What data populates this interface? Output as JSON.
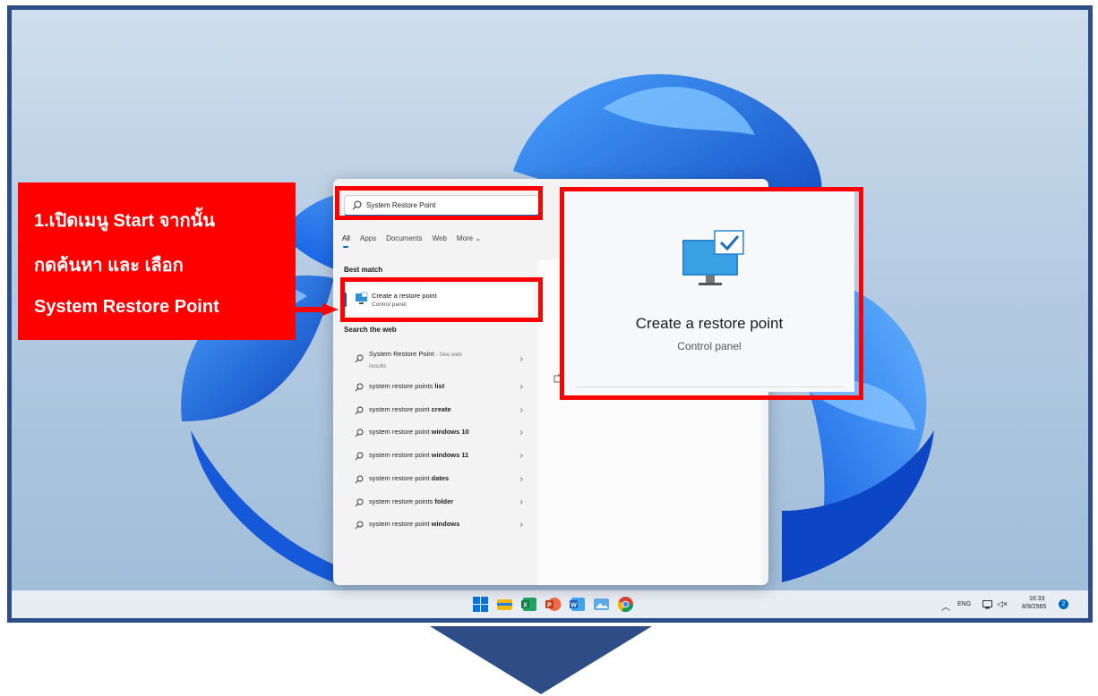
{
  "search": {
    "query": "System Restore Point"
  },
  "tabs": [
    "All",
    "Apps",
    "Documents",
    "Web",
    "More ⌄"
  ],
  "best_match": {
    "heading": "Best match",
    "title": "Create a restore point",
    "subtitle": "Control panel"
  },
  "web": {
    "heading": "Search the web",
    "first": {
      "query": "System Restore Point",
      "suffix": "- See web",
      "suffix2": "results"
    },
    "suggestions": [
      {
        "prefix": "system restore points ",
        "bold": "list"
      },
      {
        "prefix": "system restore point ",
        "bold": "create"
      },
      {
        "prefix": "system restore point ",
        "bold": "windows 10"
      },
      {
        "prefix": "system restore point ",
        "bold": "windows 11"
      },
      {
        "prefix": "system restore point ",
        "bold": "dates"
      },
      {
        "prefix": "system restore points ",
        "bold": "folder"
      },
      {
        "prefix": "system restore point ",
        "bold": "windows"
      }
    ]
  },
  "detail": {
    "title": "Create a restore point",
    "subtitle": "Control panel"
  },
  "callout": {
    "line1": "1.เปิดเมนู Start จากนั้น",
    "line2": "กดค้นหา และ เลือก",
    "line3": "System Restore Point"
  },
  "tray": {
    "language": "ENG",
    "time": "16:33",
    "date": "8/9/2565",
    "notification_count": "2"
  },
  "taskbar_icons": [
    "windows-start-icon",
    "file-explorer-icon",
    "excel-icon",
    "powerpoint-icon",
    "word-icon",
    "photos-icon",
    "chrome-icon"
  ],
  "colors": {
    "highlight": "#ff0000",
    "frame": "#2e4d86",
    "accent": "#0067c0"
  }
}
